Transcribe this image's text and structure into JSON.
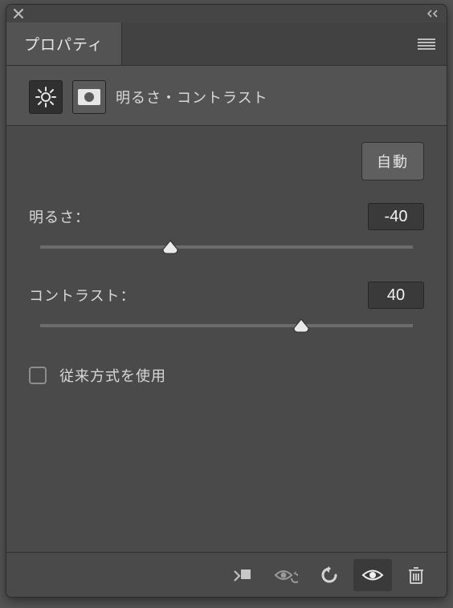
{
  "tab": {
    "title": "プロパティ"
  },
  "adjustment": {
    "title": "明るさ・コントラスト"
  },
  "buttons": {
    "auto": "自動"
  },
  "brightness": {
    "label": "明るさ：",
    "value": "-40",
    "slider_percent": 35
  },
  "contrast": {
    "label": "コントラスト：",
    "value": "40",
    "slider_percent": 70
  },
  "legacy": {
    "label": "従来方式を使用",
    "checked": false
  },
  "icons": {
    "close": "close-icon",
    "collapse": "collapse-icon",
    "menu": "menu-icon",
    "sun": "sun-icon",
    "mask": "mask-icon",
    "clip": "clip-to-layer-icon",
    "view_prev": "view-previous-icon",
    "reset": "reset-icon",
    "visibility": "visibility-icon",
    "trash": "trash-icon"
  }
}
